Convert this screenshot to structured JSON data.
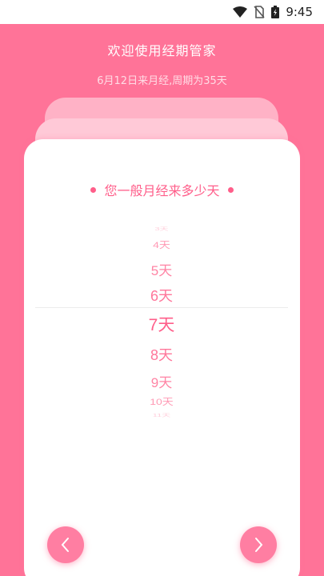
{
  "status_bar": {
    "time": "9:45",
    "icons": [
      "wifi-icon",
      "no-sim-icon",
      "battery-charging-icon"
    ]
  },
  "header": {
    "title": "欢迎使用经期管家",
    "subtitle": "6月12日来月经,周期为35天"
  },
  "question": {
    "text": "您一般月经来多少天"
  },
  "picker": {
    "items": [
      "3天",
      "4天",
      "5天",
      "6天",
      "7天",
      "8天",
      "9天",
      "10天",
      "11天"
    ],
    "selected": "7天"
  },
  "nav": {
    "prev_icon": "chevron-left-icon",
    "next_icon": "chevron-right-icon"
  },
  "colors": {
    "background": "#ff7398",
    "accent": "#ff5e8a",
    "card": "#ffffff",
    "back_card_1": "#ffc9d7",
    "back_card_2": "#ffb2c6"
  }
}
